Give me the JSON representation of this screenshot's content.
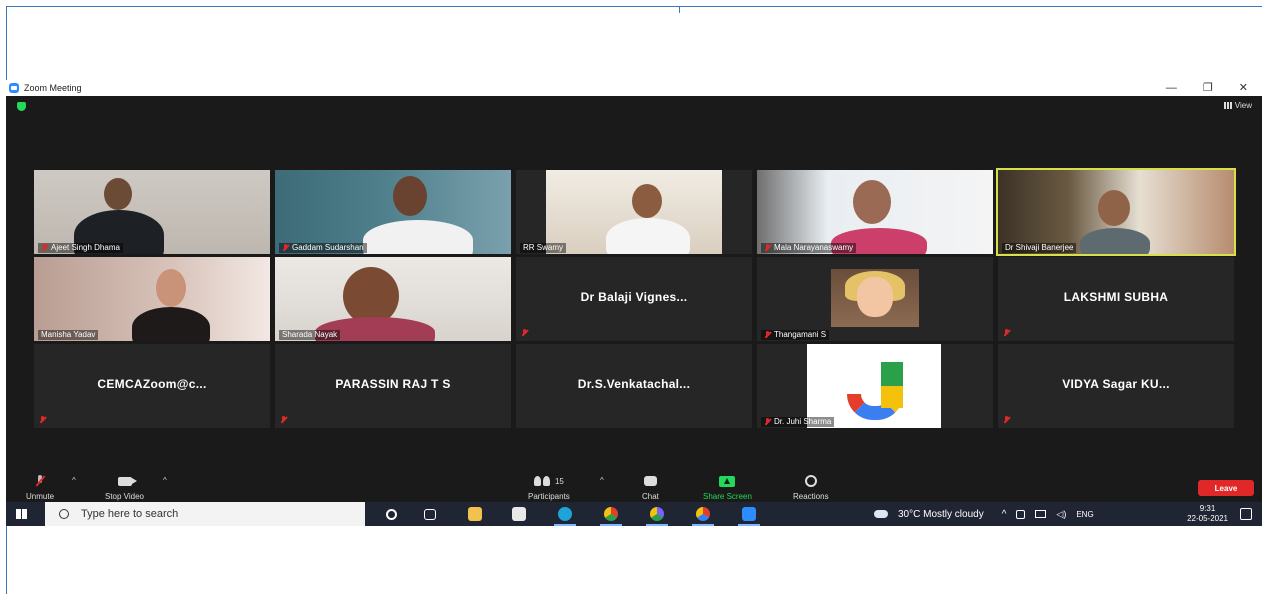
{
  "window": {
    "title": "Zoom Meeting",
    "controls": [
      "—",
      "❐",
      "✕"
    ]
  },
  "topbar": {
    "view_label": "View"
  },
  "participants": [
    {
      "name": "Ajeet Singh Dhama",
      "muted": true,
      "video": true
    },
    {
      "name": "Gaddam Sudarshan",
      "muted": true,
      "video": true
    },
    {
      "name": "RR Swamy",
      "muted": false,
      "video": true
    },
    {
      "name": "Mala Narayanaswamy",
      "muted": true,
      "video": true
    },
    {
      "name": "Dr Shivaji Banerjee",
      "muted": false,
      "video": true,
      "active_speaker": true
    },
    {
      "name": "Manisha Yadav",
      "muted": false,
      "video": true
    },
    {
      "name": "Sharada Nayak",
      "muted": false,
      "video": true
    },
    {
      "name": "Dr Balaji Vignes...",
      "muted": true,
      "video": false
    },
    {
      "name": "Thangamani S",
      "muted": true,
      "video": true
    },
    {
      "name": "LAKSHMI SUBHA",
      "muted": true,
      "video": false
    },
    {
      "name": "CEMCAZoom@c...",
      "muted": true,
      "video": false
    },
    {
      "name": "PARASSIN RAJ T S",
      "muted": true,
      "video": false
    },
    {
      "name": "Dr.S.Venkatachal...",
      "muted": false,
      "video": false
    },
    {
      "name": "Dr. Juhi Sharma",
      "muted": true,
      "video": true
    },
    {
      "name": "VIDYA Sagar KU...",
      "muted": true,
      "video": false
    }
  ],
  "controls": {
    "unmute": "Unmute",
    "stop_video": "Stop Video",
    "participants": "Participants",
    "participants_count": "15",
    "chat": "Chat",
    "share_screen": "Share Screen",
    "reactions": "Reactions",
    "leave": "Leave",
    "caret": "^"
  },
  "taskbar": {
    "search_placeholder": "Type here to search",
    "weather": "30°C  Mostly cloudy",
    "tray_caret": "^",
    "language": "ENG",
    "time": "9:31",
    "date": "22-05-2021"
  },
  "colors": {
    "meeting_bg": "#1a1a1a",
    "tile_bg": "#262626",
    "active_speaker_border": "#d7e04a",
    "share_green": "#23d959",
    "leave_red": "#e02828",
    "taskbar_bg": "#1f2533"
  }
}
